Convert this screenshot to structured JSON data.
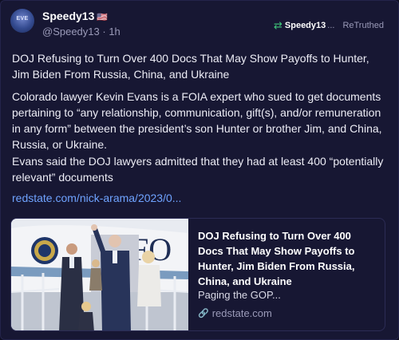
{
  "author": {
    "display_name": "Speedy13",
    "flag": "🇺🇸",
    "handle": "@Speedy13",
    "time": "1h",
    "avatar_text": "EVE"
  },
  "retruth": {
    "icon": "retruth-icon",
    "user": "Speedy13",
    "ellipsis": "...",
    "label": "ReTruthed"
  },
  "body": {
    "paragraphs": [
      "DOJ Refusing to Turn Over 400 Docs That May Show Payoffs to Hunter, Jim Biden From Russia, China, and Ukraine",
      "Colorado lawyer Kevin Evans is a FOIA expert who sued to get documents pertaining to “any relationship, communication, gift(s), and/or remuneration in any form” between the president’s son Hunter or brother Jim, and China, Russia, or Ukraine.",
      "Evans said the DOJ lawyers admitted that they had at least 400 “potentially relevant” documents"
    ],
    "link": "redstate.com/nick-arama/2023/0..."
  },
  "card": {
    "title": "DOJ Refusing to Turn Over 400 Docs That May Show Payoffs to Hunter, Jim Biden From Russia, China, and Ukraine",
    "description": "Paging the GOP...",
    "domain": "redstate.com",
    "image_watermark": "FO"
  },
  "colors": {
    "background": "#0f0f24",
    "panel": "#171733",
    "link": "#6fa3ff",
    "retruth_green": "#3fc47a"
  }
}
